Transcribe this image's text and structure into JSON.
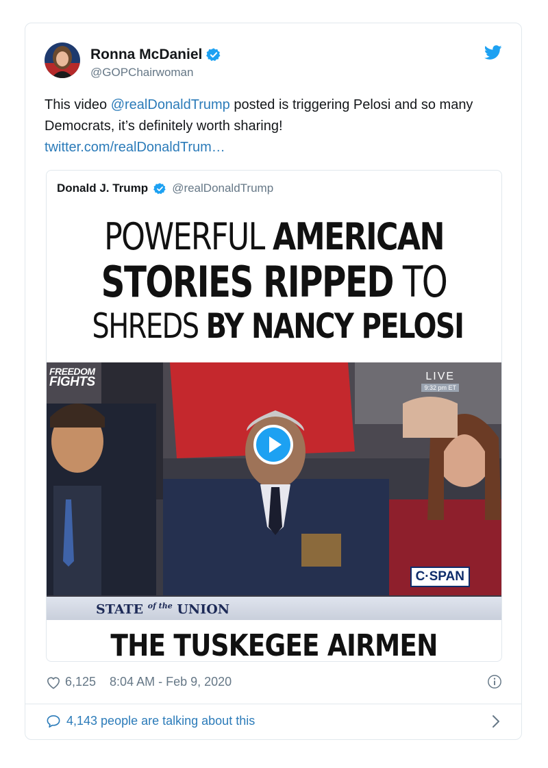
{
  "tweet": {
    "author_name": "Ronna McDaniel",
    "author_handle": "@GOPChairwoman",
    "text_before": "This video ",
    "mention": "@realDonaldTrump",
    "text_after": " posted is triggering Pelosi and so many Democrats, it’s definitely worth sharing!",
    "link": "twitter.com/realDonaldTrum…",
    "likes": "6,125",
    "time": "8:04 AM - Feb 9, 2020",
    "talking": "4,143 people are talking about this",
    "icons": {
      "avatar": "avatar",
      "verified": "verified-badge-icon",
      "brand": "twitter-bird-icon",
      "like": "heart-icon",
      "info": "info-icon",
      "reply": "speech-bubble-icon",
      "chevron": "chevron-right-icon"
    },
    "colors": {
      "link": "#2b7bb9",
      "twitter_blue": "#1da1f2",
      "muted": "#657786"
    }
  },
  "quoted": {
    "author_name": "Donald J. Trump",
    "author_handle": "@realDonaldTrump",
    "video": {
      "title_l1_thin": "POWERFUL ",
      "title_l1_heavy": "AMERICAN",
      "title_l2_heavy": "STORIES RIPPED",
      "title_l2_thin": " TO",
      "title_l3_thin": "SHREDS ",
      "title_l3_heavy": "BY NANCY PELOSI",
      "logo_line1": "FREEDOM",
      "logo_line2": "FIGHTS",
      "live": "LIVE",
      "live_time": "9:32 pm ET",
      "network": "C·SPAN",
      "sotu_state": "STATE ",
      "sotu_of": "of the",
      "sotu_union": " UNION",
      "caption": "THE TUSKEGEE AIRMEN"
    }
  }
}
